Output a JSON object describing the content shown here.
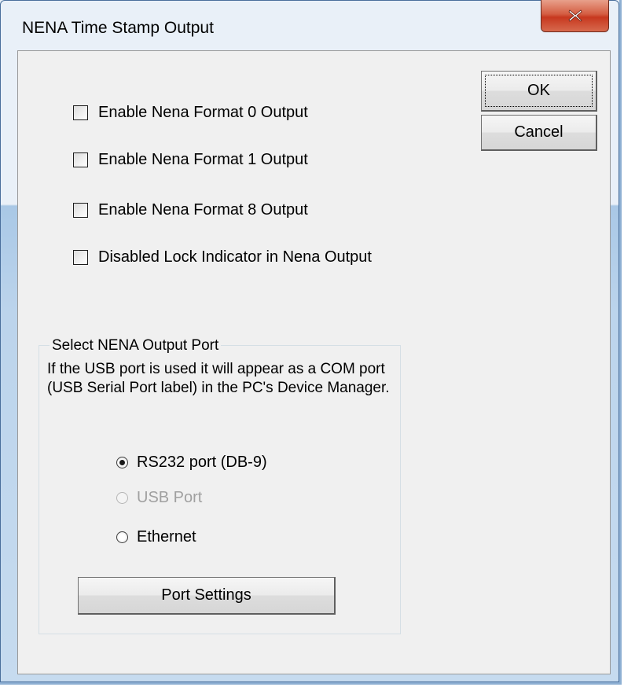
{
  "window": {
    "title": "NENA Time Stamp Output"
  },
  "checkboxes": [
    {
      "label": "Enable Nena Format 0 Output",
      "checked": false
    },
    {
      "label": "Enable Nena Format 1 Output",
      "checked": false
    },
    {
      "label": "Enable Nena Format 8 Output",
      "checked": false
    },
    {
      "label": "Disabled Lock Indicator in Nena Output",
      "checked": false
    }
  ],
  "buttons": {
    "ok_label": "OK",
    "cancel_label": "Cancel",
    "port_settings_label": "Port Settings"
  },
  "output_port_group": {
    "title": "Select NENA Output Port",
    "description": "If the USB port is used it will appear as a COM port (USB Serial Port label) in the PC's Device Manager.",
    "options": [
      {
        "label": "RS232 port (DB-9)",
        "selected": true,
        "enabled": true
      },
      {
        "label": "USB Port",
        "selected": false,
        "enabled": false
      },
      {
        "label": "Ethernet",
        "selected": false,
        "enabled": true
      }
    ]
  },
  "icons": {
    "close": "close-icon"
  },
  "colors": {
    "close_button": "#c7381f",
    "dialog_background": "#f0f0f0",
    "disabled_text": "#a0a0a0"
  }
}
